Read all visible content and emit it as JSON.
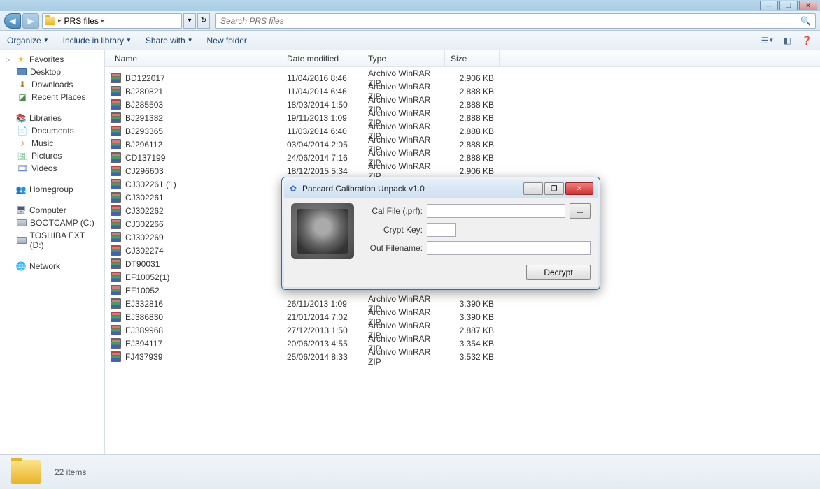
{
  "window": {
    "breadcrumb_root": "",
    "breadcrumb_folder": "PRS files",
    "search_placeholder": "Search PRS files"
  },
  "toolbar": {
    "organize": "Organize",
    "include": "Include in library",
    "share": "Share with",
    "newfolder": "New folder"
  },
  "sidebar": {
    "favorites": "Favorites",
    "desktop": "Desktop",
    "downloads": "Downloads",
    "recent": "Recent Places",
    "libraries": "Libraries",
    "documents": "Documents",
    "music": "Music",
    "pictures": "Pictures",
    "videos": "Videos",
    "homegroup": "Homegroup",
    "computer": "Computer",
    "bootcamp": "BOOTCAMP (C:)",
    "toshiba": "TOSHIBA EXT (D:)",
    "network": "Network"
  },
  "columns": {
    "name": "Name",
    "date": "Date modified",
    "type": "Type",
    "size": "Size"
  },
  "files": [
    {
      "name": "BD122017",
      "date": "11/04/2016 8:46",
      "type": "Archivo WinRAR ZIP",
      "size": "2.906 KB"
    },
    {
      "name": "BJ280821",
      "date": "11/04/2014 6:46",
      "type": "Archivo WinRAR ZIP",
      "size": "2.888 KB"
    },
    {
      "name": "BJ285503",
      "date": "18/03/2014 1:50",
      "type": "Archivo WinRAR ZIP",
      "size": "2.888 KB"
    },
    {
      "name": "BJ291382",
      "date": "19/11/2013 1:09",
      "type": "Archivo WinRAR ZIP",
      "size": "2.888 KB"
    },
    {
      "name": "BJ293365",
      "date": "11/03/2014 6:40",
      "type": "Archivo WinRAR ZIP",
      "size": "2.888 KB"
    },
    {
      "name": "BJ296112",
      "date": "03/04/2014 2:05",
      "type": "Archivo WinRAR ZIP",
      "size": "2.888 KB"
    },
    {
      "name": "CD137199",
      "date": "24/06/2014 7:16",
      "type": "Archivo WinRAR ZIP",
      "size": "2.888 KB"
    },
    {
      "name": "CJ296603",
      "date": "18/12/2015 5:34",
      "type": "Archivo WinRAR ZIP",
      "size": "2.906 KB"
    },
    {
      "name": "CJ302261 (1)",
      "date": "",
      "type": "",
      "size": ""
    },
    {
      "name": "CJ302261",
      "date": "",
      "type": "",
      "size": ""
    },
    {
      "name": "CJ302262",
      "date": "",
      "type": "",
      "size": ""
    },
    {
      "name": "CJ302266",
      "date": "",
      "type": "",
      "size": ""
    },
    {
      "name": "CJ302269",
      "date": "",
      "type": "",
      "size": ""
    },
    {
      "name": "CJ302274",
      "date": "",
      "type": "",
      "size": ""
    },
    {
      "name": "DT90031",
      "date": "",
      "type": "",
      "size": ""
    },
    {
      "name": "EF10052(1)",
      "date": "",
      "type": "",
      "size": ""
    },
    {
      "name": "EF10052",
      "date": "",
      "type": "",
      "size": ""
    },
    {
      "name": "EJ332816",
      "date": "26/11/2013 1:09",
      "type": "Archivo WinRAR ZIP",
      "size": "3.390 KB"
    },
    {
      "name": "EJ386830",
      "date": "21/01/2014 7:02",
      "type": "Archivo WinRAR ZIP",
      "size": "3.390 KB"
    },
    {
      "name": "EJ389968",
      "date": "27/12/2013 1:50",
      "type": "Archivo WinRAR ZIP",
      "size": "2.887 KB"
    },
    {
      "name": "EJ394117",
      "date": "20/06/2013 4:55",
      "type": "Archivo WinRAR ZIP",
      "size": "3.354 KB"
    },
    {
      "name": "FJ437939",
      "date": "25/06/2014 8:33",
      "type": "Archivo WinRAR ZIP",
      "size": "3.532 KB"
    }
  ],
  "status": {
    "items": "22 items"
  },
  "dialog": {
    "title": "Paccard Calibration Unpack v1.0",
    "cal_label": "Cal File (.prf):",
    "crypt_label": "Crypt Key:",
    "out_label": "Out Filename:",
    "browse": "...",
    "decrypt": "Decrypt"
  }
}
